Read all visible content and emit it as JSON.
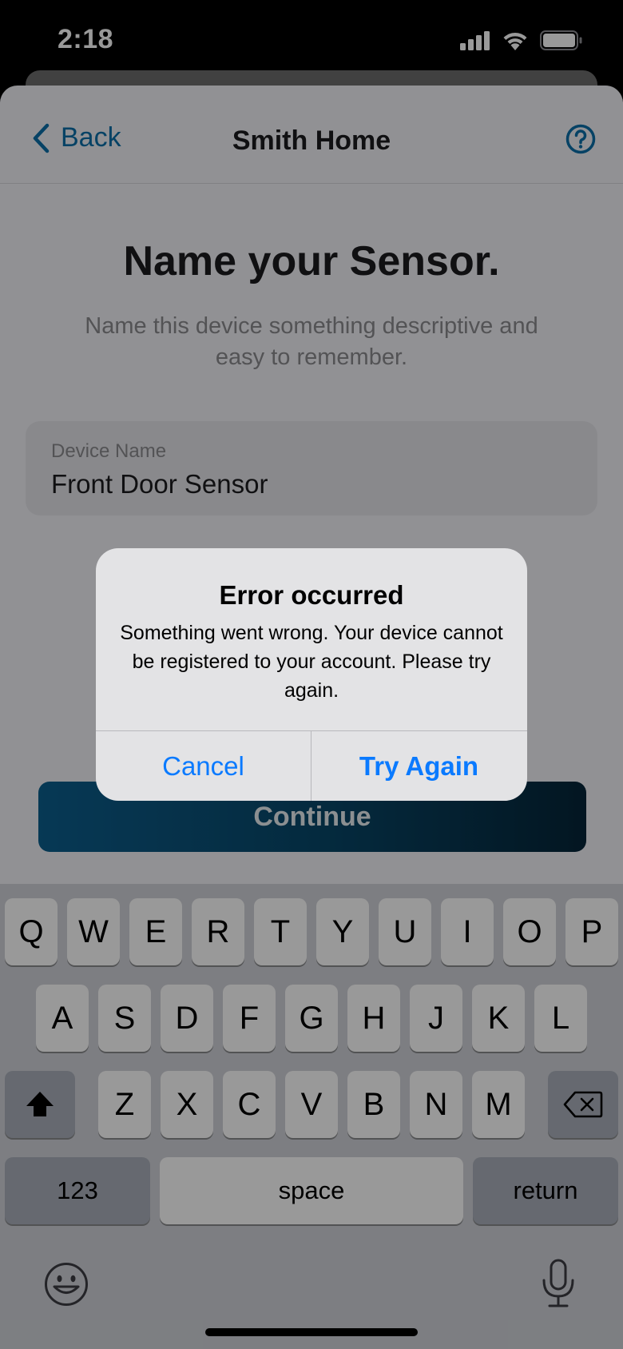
{
  "status_bar": {
    "time": "2:18"
  },
  "nav": {
    "back_label": "Back",
    "title": "Smith Home"
  },
  "page": {
    "heading": "Name your Sensor.",
    "subtitle": "Name this device something descriptive and easy to remember.",
    "field_label": "Device Name",
    "field_value": "Front Door Sensor",
    "continue_label": "Continue"
  },
  "alert": {
    "title": "Error occurred",
    "message": "Something went wrong. Your device cannot be registered to your account. Please try again.",
    "cancel_label": "Cancel",
    "retry_label": "Try Again"
  },
  "keyboard": {
    "row1": [
      "Q",
      "W",
      "E",
      "R",
      "T",
      "Y",
      "U",
      "I",
      "O",
      "P"
    ],
    "row2": [
      "A",
      "S",
      "D",
      "F",
      "G",
      "H",
      "J",
      "K",
      "L"
    ],
    "row3": [
      "Z",
      "X",
      "C",
      "V",
      "B",
      "N",
      "M"
    ],
    "numbers_label": "123",
    "space_label": "space",
    "return_label": "return"
  },
  "colors": {
    "accent": "#0a6fa8",
    "alert_button": "#0a7aff",
    "continue_bg": "#084566"
  }
}
